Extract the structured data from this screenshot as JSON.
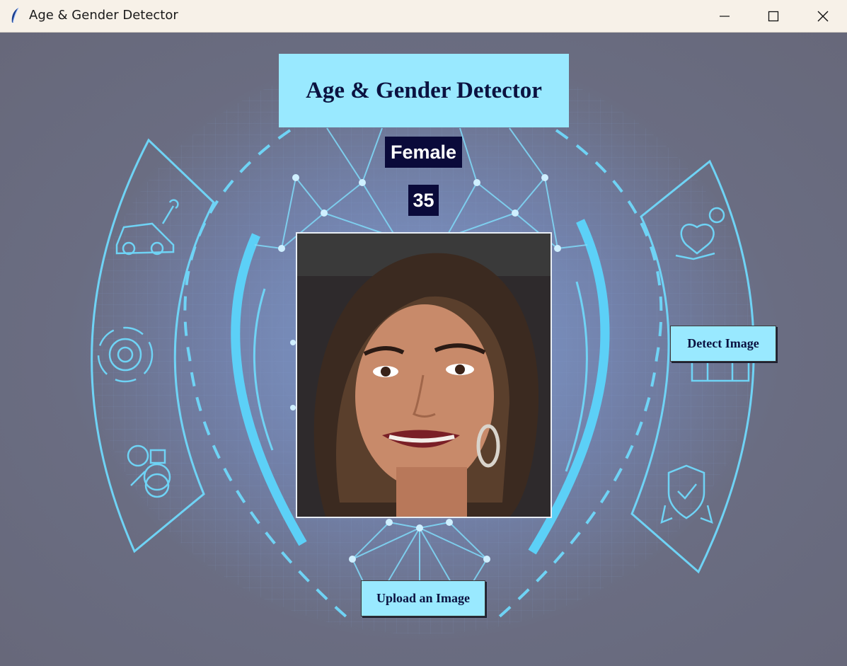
{
  "window": {
    "title": "Age & Gender Detector",
    "controls": [
      "minimize-icon",
      "maximize-icon",
      "close-icon"
    ]
  },
  "main": {
    "heading": "Age & Gender Detector",
    "gender_result": "Female",
    "age_result": "35",
    "detect_button": "Detect Image",
    "upload_button": "Upload an Image"
  },
  "icons": [
    "car-wrench-icon",
    "gear-cycle-icon",
    "analytics-icon",
    "health-heart-icon",
    "building-icon",
    "shield-check-icon"
  ],
  "colors": {
    "accent": "#99e9ff",
    "label_bg": "#0a0a3a",
    "heading_text": "#0b1240",
    "line": "#6fd3f5"
  }
}
